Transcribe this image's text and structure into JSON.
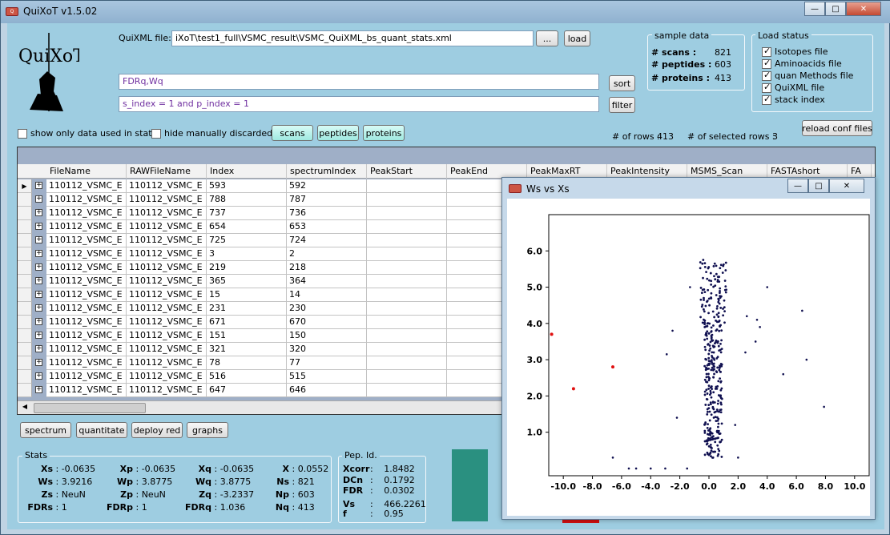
{
  "window": {
    "title": "QuiXoT v1.5.02"
  },
  "logo": {
    "text": "QuiXoT"
  },
  "quixml": {
    "label": "QuiXML file:",
    "value": "iXoT\\test1_full\\VSMC_result\\VSMC_QuiXML_bs_quant_stats.xml",
    "browse_label": "...",
    "load_label": "load"
  },
  "sort": {
    "value": "FDRq,Wq",
    "button": "sort"
  },
  "filter": {
    "value": "s_index = 1 and p_index = 1",
    "button": "filter"
  },
  "sample_data": {
    "title": "sample data",
    "scans_label": "# scans :",
    "scans": "821",
    "peptides_label": "# peptides :",
    "peptides": "603",
    "proteins_label": "# proteins :",
    "proteins": "413"
  },
  "load_status": {
    "title": "Load status",
    "items": [
      "Isotopes file",
      "Aminoacids file",
      "quan Methods file",
      "QuiXML file",
      "stack index"
    ]
  },
  "options": {
    "show_only": "show only data used in stats",
    "hide_discarded": "hide manually discarded"
  },
  "view_buttons": [
    "scans",
    "peptides",
    "proteins"
  ],
  "rows_info": {
    "rows_label": "# of rows :",
    "rows": "413",
    "selected_label": "# of  selected rows :",
    "selected": "3"
  },
  "reload_button": "reload conf files",
  "grid": {
    "columns": [
      "FileName",
      "RAWFileName",
      "Index",
      "spectrumIndex",
      "PeakStart",
      "PeakEnd",
      "PeakMaxRT",
      "PeakIntensity",
      "MSMS_Scan",
      "FASTAshort",
      "FA"
    ],
    "rows": [
      [
        "110112_VSMC_E",
        "110112_VSMC_E",
        "593",
        "592"
      ],
      [
        "110112_VSMC_E",
        "110112_VSMC_E",
        "788",
        "787"
      ],
      [
        "110112_VSMC_E",
        "110112_VSMC_E",
        "737",
        "736"
      ],
      [
        "110112_VSMC_E",
        "110112_VSMC_E",
        "654",
        "653"
      ],
      [
        "110112_VSMC_E",
        "110112_VSMC_E",
        "725",
        "724"
      ],
      [
        "110112_VSMC_E",
        "110112_VSMC_E",
        "3",
        "2"
      ],
      [
        "110112_VSMC_E",
        "110112_VSMC_E",
        "219",
        "218"
      ],
      [
        "110112_VSMC_E",
        "110112_VSMC_E",
        "365",
        "364"
      ],
      [
        "110112_VSMC_E",
        "110112_VSMC_E",
        "15",
        "14"
      ],
      [
        "110112_VSMC_E",
        "110112_VSMC_E",
        "231",
        "230"
      ],
      [
        "110112_VSMC_E",
        "110112_VSMC_E",
        "671",
        "670"
      ],
      [
        "110112_VSMC_E",
        "110112_VSMC_E",
        "151",
        "150"
      ],
      [
        "110112_VSMC_E",
        "110112_VSMC_E",
        "321",
        "320"
      ],
      [
        "110112_VSMC_E",
        "110112_VSMC_E",
        "78",
        "77"
      ],
      [
        "110112_VSMC_E",
        "110112_VSMC_E",
        "516",
        "515"
      ],
      [
        "110112_VSMC_E",
        "110112_VSMC_E",
        "647",
        "646"
      ]
    ]
  },
  "actions": [
    "spectrum",
    "quantitate",
    "deploy red",
    "graphs"
  ],
  "stats": {
    "title": "Stats",
    "rows": [
      [
        {
          "k": "Xs",
          "v": "-0.0635"
        },
        {
          "k": "Xp",
          "v": "-0.0635"
        },
        {
          "k": "Xq",
          "v": "-0.0635"
        },
        {
          "k": "X",
          "v": "0.0552"
        }
      ],
      [
        {
          "k": "Ws",
          "v": "3.9216"
        },
        {
          "k": "Wp",
          "v": "3.8775"
        },
        {
          "k": "Wq",
          "v": "3.8775"
        },
        {
          "k": "Ns",
          "v": "821"
        }
      ],
      [
        {
          "k": "Zs",
          "v": "NeuN"
        },
        {
          "k": "Zp",
          "v": "NeuN"
        },
        {
          "k": "Zq",
          "v": "-3.2337"
        },
        {
          "k": "Np",
          "v": "603"
        }
      ],
      [
        {
          "k": "FDRs",
          "v": "1"
        },
        {
          "k": "FDRp",
          "v": "1"
        },
        {
          "k": "FDRq",
          "v": "1.036"
        },
        {
          "k": "Nq",
          "v": "413"
        }
      ]
    ]
  },
  "pep_id": {
    "title": "Pep. Id.",
    "items": [
      {
        "k": "Xcorr",
        "v": "1.8482"
      },
      {
        "k": "DCn",
        "v": "0.1792"
      },
      {
        "k": "FDR",
        "v": "0.0302"
      },
      {
        "k": "Vs",
        "v": "466.2261"
      },
      {
        "k": "f",
        "v": "0.95"
      }
    ]
  },
  "colors": {
    "teal_block": "#2a9080",
    "red_bar": "#d01010",
    "point": "#101050",
    "highlight": "#e01010"
  },
  "plot_window": {
    "title": "Ws vs Xs",
    "chart_data": {
      "type": "scatter",
      "title": "",
      "xlabel": "",
      "ylabel": "",
      "xlim": [
        -11,
        11
      ],
      "ylim": [
        -0.2,
        7
      ],
      "xticks": [
        "-10.0",
        "-8.0",
        "-6.0",
        "-4.0",
        "-2.0",
        "0.0",
        "2.0",
        "4.0",
        "6.0",
        "8.0",
        "10.0"
      ],
      "yticks": [
        "1.0",
        "2.0",
        "3.0",
        "4.0",
        "5.0",
        "6.0"
      ],
      "highlighted": [
        [
          -10.8,
          3.7
        ],
        [
          -9.3,
          2.2
        ],
        [
          -6.6,
          2.8
        ]
      ],
      "outliers": [
        [
          -4.0,
          0.0
        ],
        [
          -5.0,
          0.0
        ],
        [
          -5.5,
          0.0
        ],
        [
          -6.6,
          0.3
        ],
        [
          -3.0,
          0.0
        ],
        [
          -1.5,
          0.0
        ],
        [
          -2.2,
          1.4
        ],
        [
          -2.9,
          3.15
        ],
        [
          -2.5,
          3.8
        ],
        [
          2.6,
          4.2
        ],
        [
          3.3,
          4.1
        ],
        [
          3.5,
          3.9
        ],
        [
          3.2,
          3.5
        ],
        [
          4.0,
          5.0
        ],
        [
          5.1,
          2.6
        ],
        [
          6.4,
          4.35
        ],
        [
          6.7,
          3.0
        ],
        [
          7.9,
          1.7
        ],
        [
          -1.3,
          5.0
        ],
        [
          2.5,
          3.2
        ],
        [
          2.0,
          0.3
        ],
        [
          1.8,
          1.2
        ]
      ]
    }
  }
}
